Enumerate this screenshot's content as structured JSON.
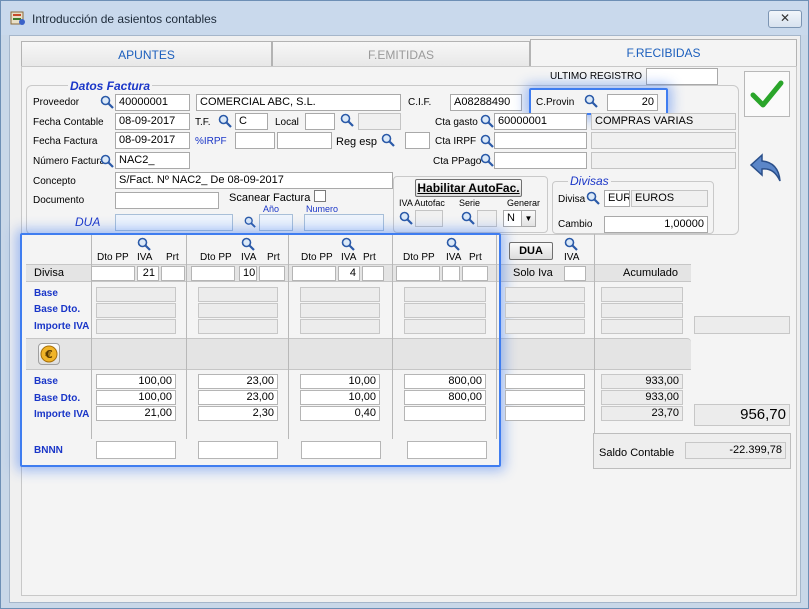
{
  "window": {
    "title": "Introducción de asientos contables",
    "close_icon": "close-icon"
  },
  "tabs": [
    {
      "label": "APUNTES"
    },
    {
      "label": "F.EMITIDAS"
    },
    {
      "label": "F.RECIBIDAS"
    }
  ],
  "header": {
    "ultimo_registro_label": "ULTIMO REGISTRO",
    "ultimo_registro_value": "",
    "datos_factura": "Datos Factura",
    "proveedor_label": "Proveedor",
    "proveedor_code": "40000001",
    "proveedor_name": "COMERCIAL ABC, S.L.",
    "cif_label": "C.I.F.",
    "cif_value": "A08288490",
    "cprovin_label": "C.Provin",
    "cprovin_value": "20",
    "fecha_contable_label": "Fecha Contable",
    "fecha_contable_value": "08-09-2017",
    "tf_label": "T.F.",
    "tf_value": "C",
    "local_label": "Local",
    "cta_gasto_label": "Cta gasto",
    "cta_gasto_value": "60000001",
    "cta_gasto_name": "COMPRAS VARIAS",
    "fecha_factura_label": "Fecha Factura",
    "fecha_factura_value": "08-09-2017",
    "irpf_label": "%IRPF",
    "reg_esp_label": "Reg esp",
    "cta_irpf_label": "Cta  IRPF",
    "numero_factura_label": "Número Factura",
    "numero_factura_value": "NAC2_",
    "cta_ppago_label": "Cta PPago",
    "concepto_label": "Concepto",
    "concepto_value": "S/Fact. Nº NAC2_ De 08-09-2017",
    "documento_label": "Documento",
    "scanear_label": "Scanear Factura",
    "dua_label": "DUA",
    "anio_label": "Año",
    "numero_label": "Numero",
    "habilitar_button": "Habilitar AutoFac.",
    "iva_autofac_label": "IVA Autofac",
    "serie_label": "Serie",
    "generar_label": "Generar",
    "generar_value": "N",
    "divisas_title": "Divisas",
    "divisa_label": "Divisa",
    "divisa_code": "EUR",
    "divisa_name": "EUROS",
    "cambio_label": "Cambio",
    "cambio_value": "1,00000"
  },
  "grid": {
    "dto_pp_label": "Dto PP",
    "iva_label": "IVA",
    "prt_label": "Prt",
    "divisa_label": "Divisa",
    "dua_button": "DUA",
    "solo_iva_label": "Solo Iva",
    "acumulado_label": "Acumulado",
    "iva_codes": [
      "21",
      "10",
      "4",
      ""
    ],
    "row_labels_top": [
      "Base",
      "Base Dto.",
      "Importe IVA"
    ],
    "row_labels_bottom": [
      "Base",
      "Base Dto.",
      "Importe IVA"
    ],
    "bnnn_label": "BNNN",
    "bases": [
      "100,00",
      "23,00",
      "10,00",
      "800,00"
    ],
    "bases_dto": [
      "100,00",
      "23,00",
      "10,00",
      "800,00"
    ],
    "importe_iva": [
      "21,00",
      "2,30",
      "0,40",
      ""
    ],
    "acumulado": [
      "933,00",
      "933,00",
      "23,70"
    ],
    "total": "956,70",
    "saldo_label": "Saldo Contable",
    "saldo_value": "-22.399,78"
  },
  "colors": {
    "accent": "#1c5fbd",
    "highlight": "#3f7df0",
    "ok_green": "#2aa52a"
  }
}
